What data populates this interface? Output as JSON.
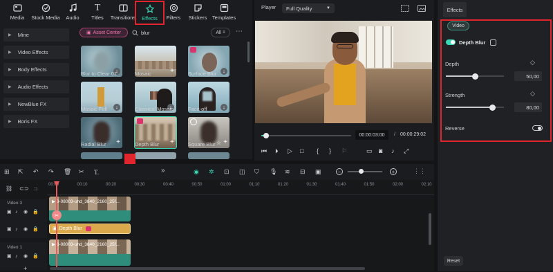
{
  "toolbar": {
    "items": [
      {
        "label": "Media",
        "icon": "media-icon"
      },
      {
        "label": "Stock Media",
        "icon": "stock-media-icon"
      },
      {
        "label": "Audio",
        "icon": "audio-icon"
      },
      {
        "label": "Titles",
        "icon": "titles-icon"
      },
      {
        "label": "Transitions",
        "icon": "transitions-icon"
      },
      {
        "label": "Effects",
        "icon": "effects-icon"
      },
      {
        "label": "Filters",
        "icon": "filters-icon"
      },
      {
        "label": "Stickers",
        "icon": "stickers-icon"
      },
      {
        "label": "Templates",
        "icon": "templates-icon"
      }
    ],
    "active": "Effects"
  },
  "sidebar": {
    "items": [
      {
        "label": "Mine"
      },
      {
        "label": "Video Effects"
      },
      {
        "label": "Body Effects"
      },
      {
        "label": "Audio Effects"
      },
      {
        "label": "NewBlue FX"
      },
      {
        "label": "Boris FX"
      }
    ]
  },
  "effects": {
    "asset_center": "Asset Center",
    "search_value": "blur",
    "filter_label": "All",
    "tiles": [
      {
        "label": "Blur to Clear 01"
      },
      {
        "label": "Mosaic"
      },
      {
        "label": "Surface Blur"
      },
      {
        "label": "Mosaic Full"
      },
      {
        "label": "Classical Mosaic"
      },
      {
        "label": "Face-off"
      },
      {
        "label": "Radial Blur"
      },
      {
        "label": "Depth Blur"
      },
      {
        "label": "Square Blur"
      }
    ]
  },
  "player": {
    "label": "Player",
    "quality": "Full Quality",
    "current_time": "00:00:03:00",
    "separator": "/",
    "total_time": "00:00:29:02",
    "progress_fraction": 0.06
  },
  "panel": {
    "tab": "Effects",
    "subtab": "Video",
    "effect_name": "Depth Blur",
    "effect_enabled": true,
    "depth_label": "Depth",
    "depth_value": "50,00",
    "depth_fraction": 0.5,
    "strength_label": "Strength",
    "strength_value": "80,00",
    "strength_fraction": 0.8,
    "reverse_label": "Reverse",
    "reverse_on": false,
    "reset_label": "Reset"
  },
  "timeline": {
    "ticks": [
      "00:00",
      "00:10",
      "00:20",
      "00:30",
      "00:40",
      "00:50",
      "01:00",
      "01:10",
      "01:20",
      "01:30",
      "01:40",
      "01:50",
      "02:00",
      "02:10"
    ],
    "tracks": [
      {
        "label": "Video 3"
      },
      {
        "label": ""
      },
      {
        "label": "Video 1"
      }
    ],
    "clip_top_label": "3-08003-uhd_3840_2160_25f...",
    "clip_effect_label": "Depth Blur",
    "clip_bottom_label": "3-08003-uhd_3840_2160_25f..."
  },
  "colors": {
    "accent": "#38d9b6",
    "highlight": "#e0252d",
    "effect_clip": "#d9a94c",
    "video_clip": "#2f8d7c"
  }
}
